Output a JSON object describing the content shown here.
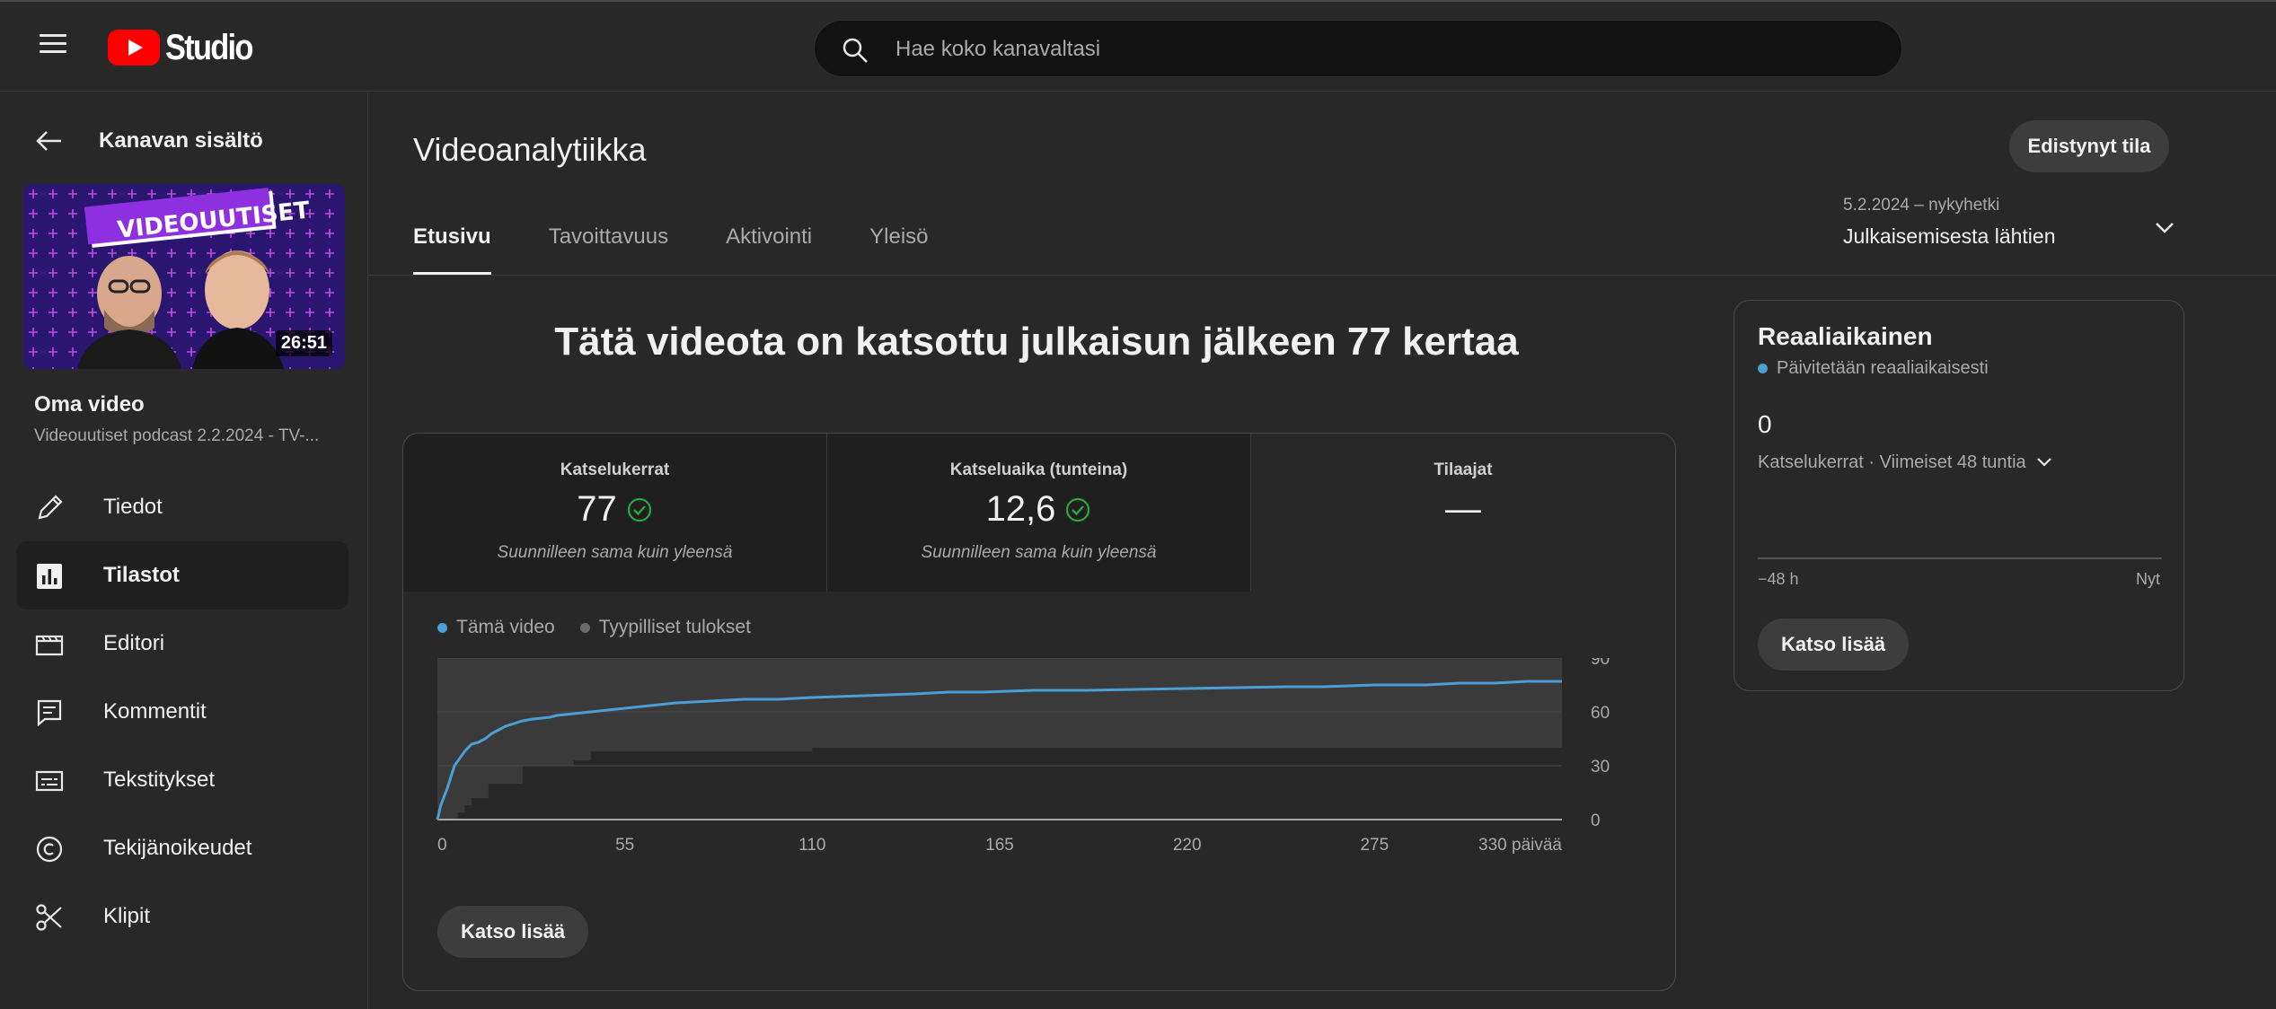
{
  "header": {
    "logo_text": "Studio",
    "search_placeholder": "Hae koko kanavaltasi"
  },
  "sidebar": {
    "back_label": "Kanavan sisältö",
    "thumbnail_duration": "26:51",
    "thumbnail_text": "VIDEOUUTISET",
    "video_title": "Oma video",
    "video_subtitle": "Videouutiset podcast 2.2.2024 - TV-...",
    "items": [
      {
        "label": "Tiedot",
        "icon": "pencil-icon"
      },
      {
        "label": "Tilastot",
        "icon": "analytics-icon",
        "active": true
      },
      {
        "label": "Editori",
        "icon": "clapperboard-icon"
      },
      {
        "label": "Kommentit",
        "icon": "comment-icon"
      },
      {
        "label": "Tekstitykset",
        "icon": "subtitles-icon"
      },
      {
        "label": "Tekijänoikeudet",
        "icon": "copyright-icon"
      },
      {
        "label": "Klipit",
        "icon": "scissors-icon"
      }
    ]
  },
  "main": {
    "title": "Videoanalytiikka",
    "advanced_button": "Edistynyt tila",
    "tabs": [
      "Etusivu",
      "Tavoittavuus",
      "Aktivointi",
      "Yleisö"
    ],
    "date_range_label": "5.2.2024 – nykyhetki",
    "date_range_value": "Julkaisemisesta lähtien",
    "headline": "Tätä videota on katsottu julkaisun jälkeen 77 kertaa",
    "metrics": [
      {
        "label": "Katselukerrat",
        "value": "77",
        "note": "Suunnilleen sama kuin yleensä"
      },
      {
        "label": "Katseluaika (tunteina)",
        "value": "12,6",
        "note": "Suunnilleen sama kuin yleensä"
      },
      {
        "label": "Tilaajat",
        "value": "—",
        "note": ""
      }
    ],
    "see_more": "Katso lisää"
  },
  "chart_data": {
    "type": "line",
    "series": [
      {
        "name": "Tämä video",
        "color": "#4a9fd5",
        "x": [
          0,
          1,
          3,
          5,
          8,
          10,
          12,
          14,
          16,
          18,
          20,
          25,
          28,
          33,
          35,
          40,
          45,
          50,
          55,
          60,
          65,
          70,
          80,
          90,
          100,
          110,
          125,
          140,
          150,
          160,
          175,
          190,
          220,
          250,
          260,
          275,
          290,
          300,
          310,
          320,
          330
        ],
        "y": [
          0,
          8,
          18,
          30,
          38,
          42,
          43,
          45,
          48,
          50,
          52,
          55,
          56,
          57,
          58,
          59,
          60,
          61,
          62,
          63,
          64,
          65,
          66,
          67,
          67,
          68,
          69,
          70,
          71,
          71,
          72,
          72,
          73,
          74,
          74,
          75,
          75,
          76,
          76,
          77,
          77
        ]
      },
      {
        "name": "Tyypilliset tulokset",
        "color": "#555555",
        "band_x": [
          0,
          2,
          4,
          6,
          8,
          10,
          15,
          25,
          40,
          45,
          110,
          330
        ],
        "band_low": [
          0,
          0,
          0,
          4,
          8,
          12,
          20,
          30,
          33,
          38,
          40,
          50
        ],
        "band_high": [
          90,
          90,
          90,
          90,
          90,
          90,
          90,
          90,
          90,
          90,
          90,
          90
        ]
      }
    ],
    "x_ticks": [
      "0",
      "55",
      "110",
      "165",
      "220",
      "275",
      "330 päivää"
    ],
    "x_tick_values": [
      0,
      55,
      110,
      165,
      220,
      275,
      330
    ],
    "y_ticks": [
      "0",
      "30",
      "60",
      "90"
    ],
    "y_tick_values": [
      0,
      30,
      60,
      90
    ],
    "xlim": [
      0,
      330
    ],
    "ylim": [
      0,
      90
    ],
    "grid": true,
    "legend_position": "top-left"
  },
  "realtime": {
    "title": "Reaaliaikainen",
    "subtitle": "Päivitetään reaaliaikaisesti",
    "value": "0",
    "metric_label": "Katselukerrat · Viimeiset 48 tuntia",
    "x_start": "−48 h",
    "x_end": "Nyt",
    "see_more": "Katso lisää"
  }
}
